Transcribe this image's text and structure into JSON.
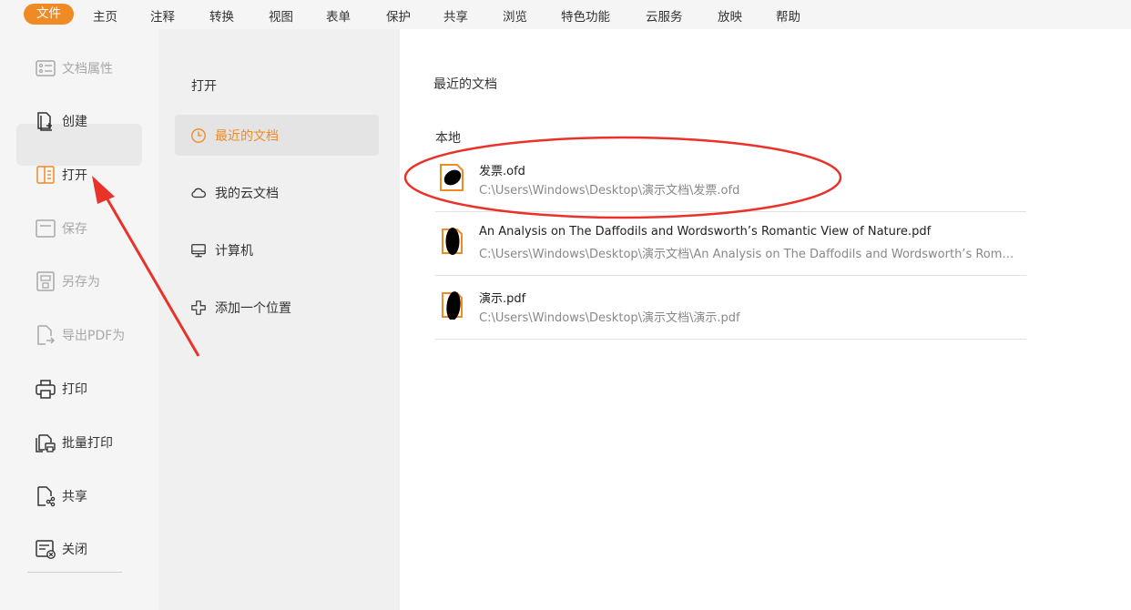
{
  "menu": {
    "items": [
      "文件",
      "主页",
      "注释",
      "转换",
      "视图",
      "表单",
      "保护",
      "共享",
      "浏览",
      "特色功能",
      "云服务",
      "放映",
      "帮助"
    ],
    "active_index": 0,
    "accent_color": "#f08a24"
  },
  "sidebar": {
    "items": [
      {
        "label": "文档属性",
        "icon": "document-properties-icon",
        "disabled": true
      },
      {
        "label": "创建",
        "icon": "create-document-icon",
        "disabled": false
      },
      {
        "label": "打开",
        "icon": "open-document-icon",
        "disabled": false,
        "active": true
      },
      {
        "label": "保存",
        "icon": "save-icon",
        "disabled": true
      },
      {
        "label": "另存为",
        "icon": "save-as-icon",
        "disabled": true
      },
      {
        "label": "导出PDF为",
        "icon": "export-pdf-icon",
        "disabled": true
      },
      {
        "label": "打印",
        "icon": "print-icon",
        "disabled": false
      },
      {
        "label": "批量打印",
        "icon": "batch-print-icon",
        "disabled": false
      },
      {
        "label": "共享",
        "icon": "share-icon",
        "disabled": false
      },
      {
        "label": "关闭",
        "icon": "close-document-icon",
        "disabled": false
      }
    ]
  },
  "open_panel": {
    "title": "打开",
    "items": [
      {
        "label": "最近的文档",
        "icon": "clock-icon",
        "active": true
      },
      {
        "label": "我的云文档",
        "icon": "cloud-icon",
        "active": false
      },
      {
        "label": "计算机",
        "icon": "computer-icon",
        "active": false
      },
      {
        "label": "添加一个位置",
        "icon": "add-location-icon",
        "active": false
      }
    ]
  },
  "main": {
    "title": "最近的文档",
    "section": "本地",
    "files": [
      {
        "name": "发票.ofd",
        "path": "C:\\Users\\Windows\\Desktop\\演示文档\\发票.ofd",
        "icon": "ofd-file-icon",
        "highlighted": true
      },
      {
        "name": "An Analysis on The Daffodils and Wordsworth’s Romantic View of Nature.pdf",
        "path": "C:\\Users\\Windows\\Desktop\\演示文档\\An Analysis on The Daffodils and Wordsworth’s Romantic View of Nature.pdf",
        "icon": "pdf-file-icon",
        "highlighted": false
      },
      {
        "name": "演示.pdf",
        "path": "C:\\Users\\Windows\\Desktop\\演示文档\\演示.pdf",
        "icon": "pdf-file-icon",
        "highlighted": false
      }
    ]
  },
  "annotation_color": "#e8322a"
}
